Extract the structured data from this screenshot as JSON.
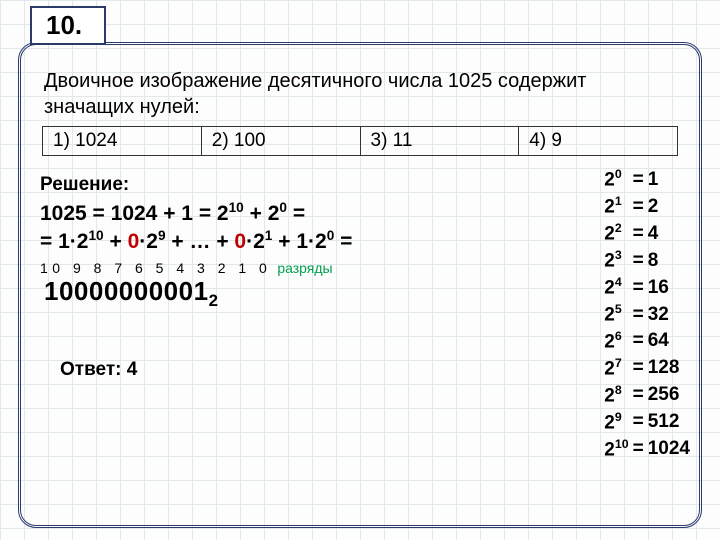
{
  "qnum": "10.",
  "question": "Двоичное изображение десятичного числа 1025 содержит значащих нулей:",
  "options": [
    "1) 1024",
    "2) 100",
    "3) 11",
    "4) 9"
  ],
  "solution_label": "Решение:",
  "line1_a": "1025 = 1024 + 1 = 2",
  "line1_b": " + 2",
  "line1_c": " =",
  "line2_a": " = 1·2",
  "line2_b": " + ",
  "line2_c": "0",
  "line2_d": "·2",
  "line2_e": " +  … + ",
  "line2_f": "0",
  "line2_g": "·2",
  "line2_h": " + 1·2",
  "line2_i": " =",
  "digits_row": "10 9 8 7 6 5 4 3 2 1 0",
  "digits_label": "разряды",
  "bignum": "10000000001",
  "bignum_sub": "2",
  "answer": "Ответ: 4",
  "powers": [
    {
      "e": "0",
      "v": "1"
    },
    {
      "e": "1",
      "v": "2"
    },
    {
      "e": "2",
      "v": "4"
    },
    {
      "e": "3",
      "v": "8"
    },
    {
      "e": "4",
      "v": "16"
    },
    {
      "e": "5",
      "v": "32"
    },
    {
      "e": "6",
      "v": "64"
    },
    {
      "e": "7",
      "v": "128"
    },
    {
      "e": "8",
      "v": "256"
    },
    {
      "e": "9",
      "v": "512"
    },
    {
      "e": "10",
      "v": "1024"
    }
  ],
  "exp10": "10",
  "exp9": "9",
  "exp1": "1",
  "exp0": "0",
  "base2": "2"
}
